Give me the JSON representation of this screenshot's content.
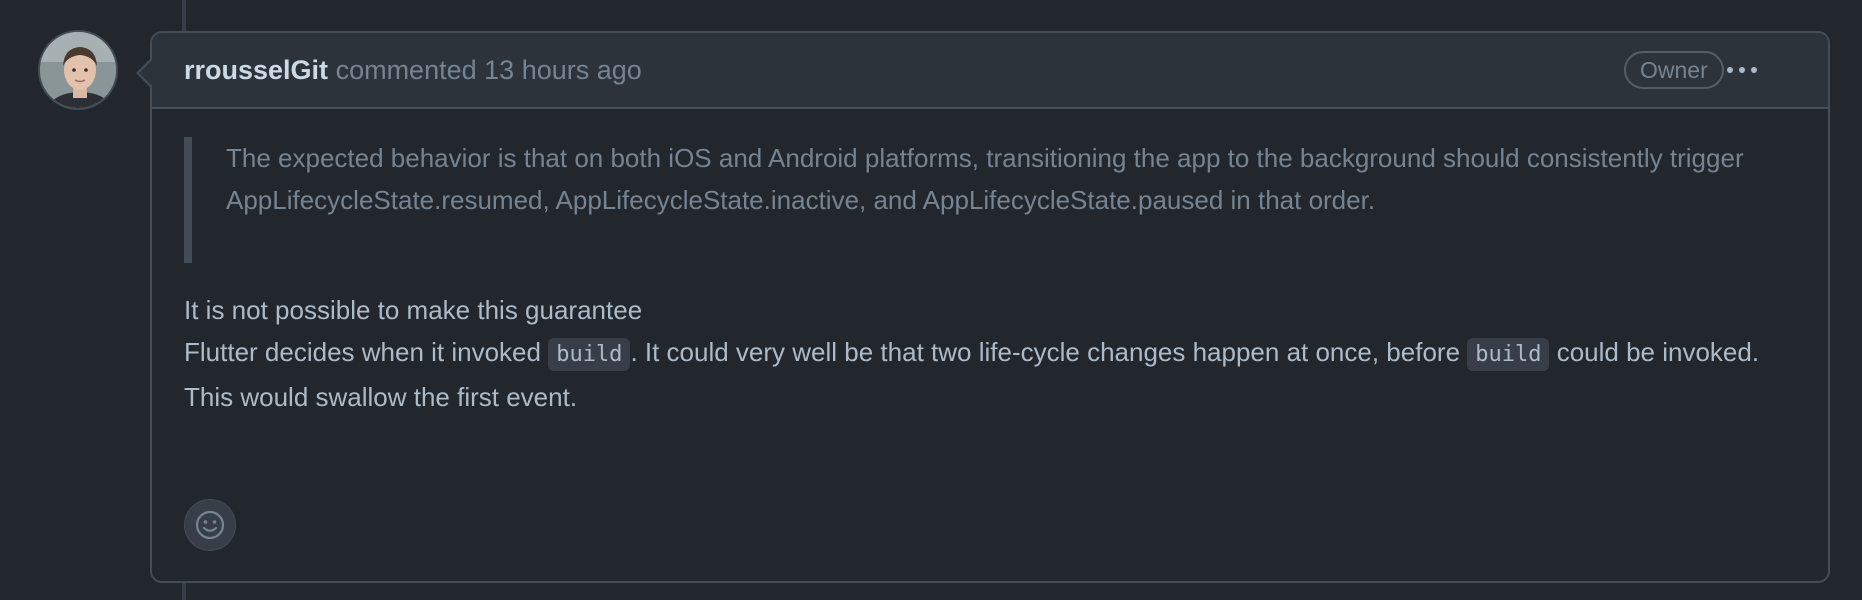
{
  "comment": {
    "author": "rrousselGit",
    "action": "commented",
    "timestamp": "13 hours ago",
    "role_badge": "Owner",
    "quote": "The expected behavior is that on both iOS and Android platforms, transitioning the app to the background should consistently trigger AppLifecycleState.resumed, AppLifecycleState.inactive, and AppLifecycleState.paused in that order.",
    "body": {
      "line1": "It is not possible to make this guarantee",
      "line2_before": "Flutter decides when it invoked ",
      "line2_code1": "build",
      "line2_middle": ". It could very well be that two life-cycle changes happen at once, before ",
      "line2_code2": "build",
      "line2_after": " could be invoked.",
      "line3": "This would swallow the first event."
    }
  },
  "icons": {
    "more": "kebab-horizontal-icon",
    "reaction": "smiley-icon"
  },
  "colors": {
    "background": "#22272e",
    "header_background": "#2d333b",
    "border": "#444c56",
    "text_primary": "#adbac7",
    "text_muted": "#768390",
    "author": "#cdd9e5",
    "code_background": "#373e47"
  }
}
